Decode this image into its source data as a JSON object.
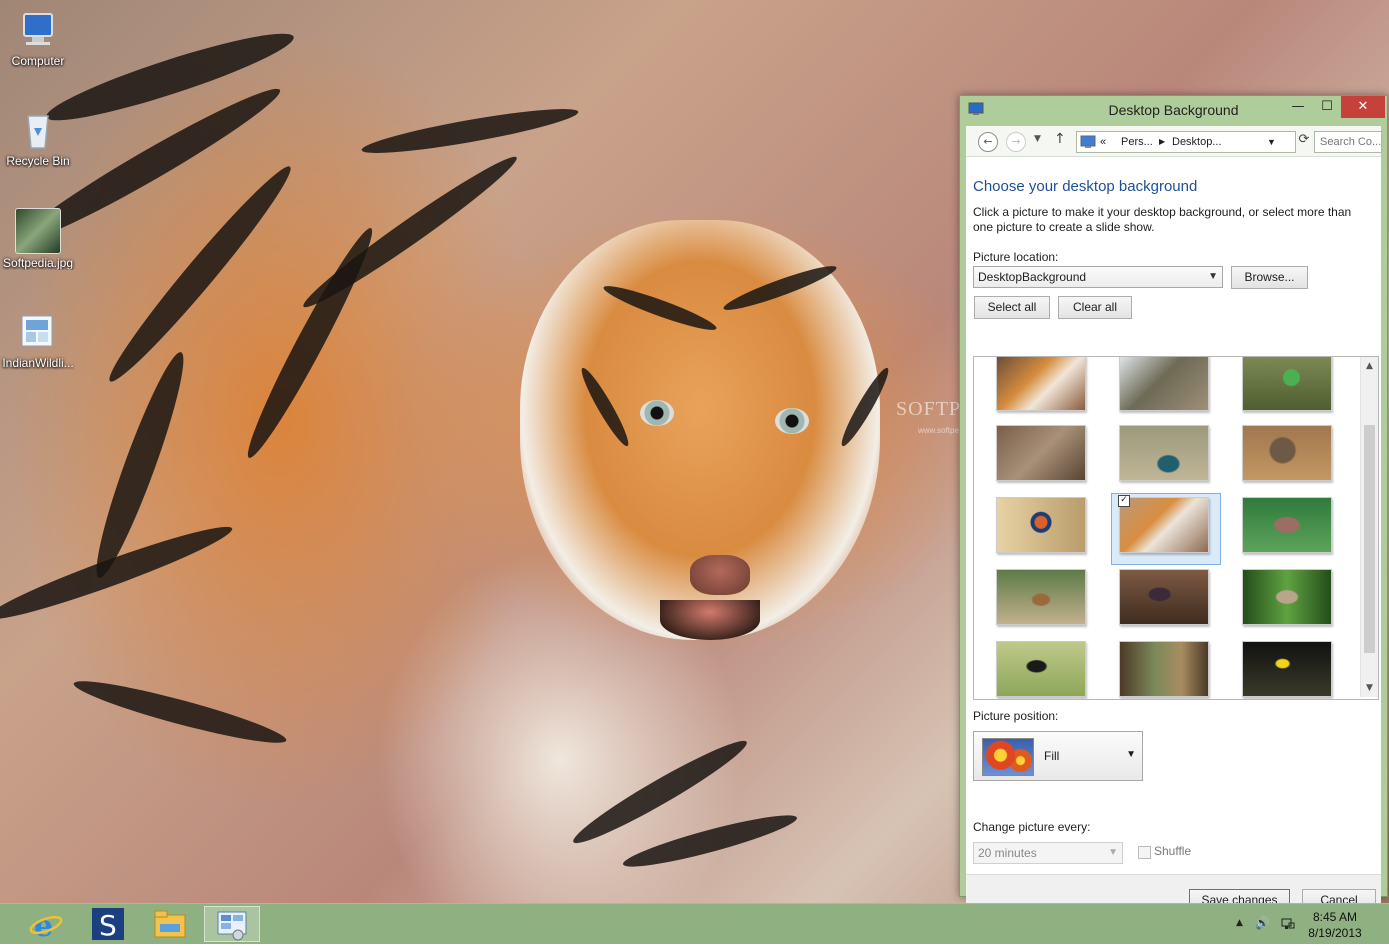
{
  "desktop": {
    "icons": [
      {
        "label": "Computer",
        "icon": "computer-icon"
      },
      {
        "label": "Recycle Bin",
        "icon": "recycle-bin-icon"
      },
      {
        "label": "Softpedia.jpg",
        "icon": "image-file-icon"
      },
      {
        "label": "IndianWildli...",
        "icon": "theme-pack-icon"
      }
    ],
    "watermark": "SOFTPEDIA",
    "watermark_url": "www.softpedia.com"
  },
  "window": {
    "title": "Desktop Background",
    "controls": {
      "minimize": "—",
      "maximize": "☐",
      "close": "✕"
    },
    "nav": {
      "breadcrumb_overflow": "«",
      "breadcrumb": [
        "Pers...",
        "Desktop..."
      ],
      "search_placeholder": "Search Co..."
    },
    "heading": "Choose your desktop background",
    "description": "Click a picture to make it your desktop background, or select more than one picture to create a slide show.",
    "picture_location": {
      "label": "Picture location:",
      "value": "DesktopBackground",
      "browse_label": "Browse..."
    },
    "select_all_label": "Select all",
    "clear_all_label": "Clear all",
    "gallery": {
      "thumbnails": [
        {
          "subject": "tiger",
          "selected": false
        },
        {
          "subject": "monkey",
          "selected": false
        },
        {
          "subject": "bee-eater",
          "selected": false
        },
        {
          "subject": "deer",
          "selected": false
        },
        {
          "subject": "peacock",
          "selected": false
        },
        {
          "subject": "owlet",
          "selected": false
        },
        {
          "subject": "bird-on-branch",
          "selected": false
        },
        {
          "subject": "tiger-walking",
          "selected": true
        },
        {
          "subject": "dove",
          "selected": false
        },
        {
          "subject": "spotted-deer",
          "selected": false
        },
        {
          "subject": "waterhen",
          "selected": false
        },
        {
          "subject": "spotted-owlet",
          "selected": false
        },
        {
          "subject": "black-bird",
          "selected": false
        },
        {
          "subject": "forest-deer",
          "selected": false
        },
        {
          "subject": "yellow-bird",
          "selected": false
        }
      ]
    },
    "picture_position": {
      "label": "Picture position:",
      "value": "Fill"
    },
    "change_picture": {
      "label": "Change picture every:",
      "value": "20 minutes",
      "shuffle_label": "Shuffle",
      "shuffle_checked": false
    },
    "save_label": "Save changes",
    "cancel_label": "Cancel"
  },
  "taskbar": {
    "apps": [
      "internet-explorer-icon",
      "softpedia-s-icon",
      "file-explorer-icon",
      "control-panel-icon"
    ],
    "clock": {
      "time": "8:45 AM",
      "date": "8/19/2013"
    }
  },
  "colors": {
    "window_frame": "#aecd9a",
    "taskbar": "#8fb181",
    "heading": "#1e4f95",
    "close_button": "#c7413c"
  }
}
